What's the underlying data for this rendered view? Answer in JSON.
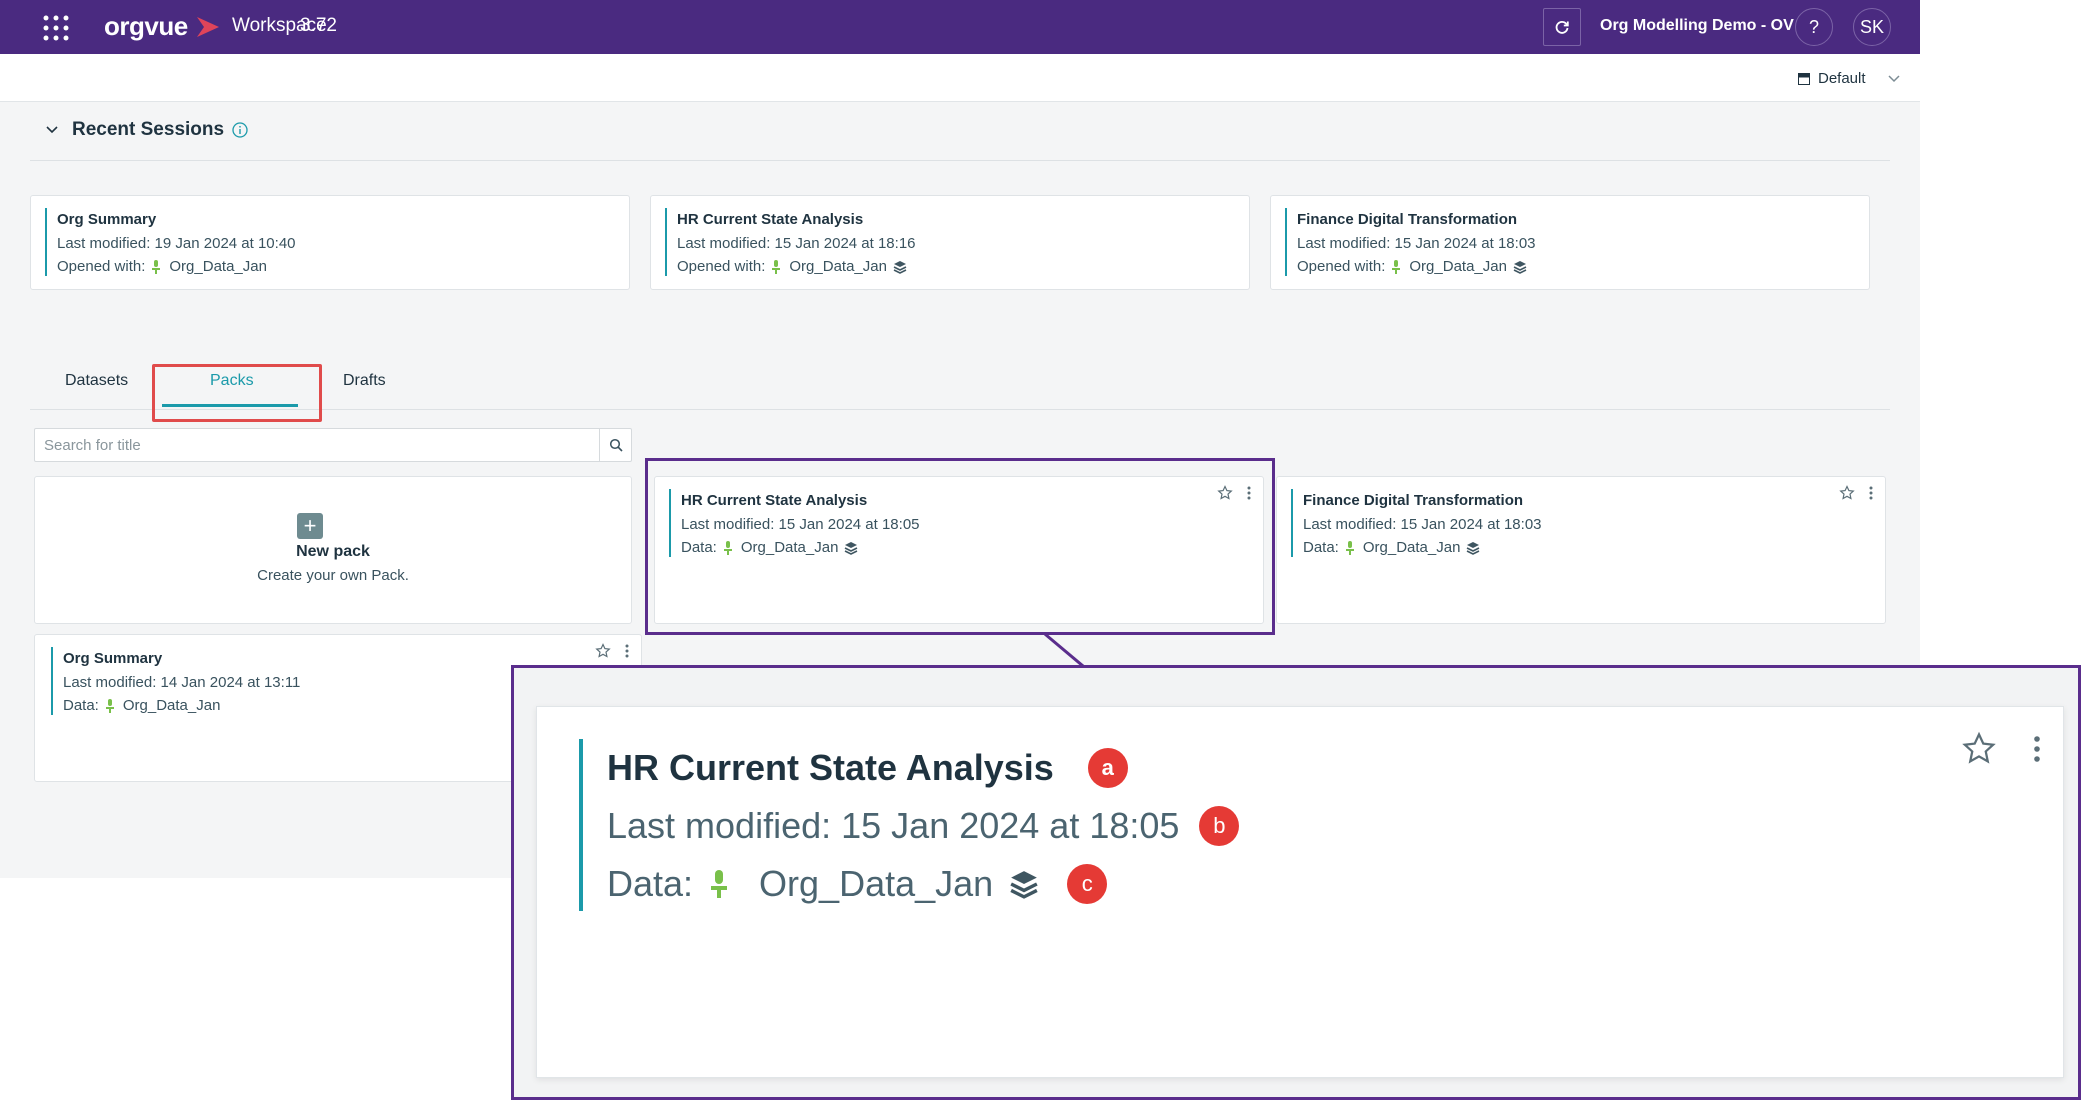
{
  "app": {
    "logo_text": "orgvue",
    "name": "Workspace",
    "version": "3.72",
    "workspace_name": "Org Modelling Demo - OV",
    "help_label": "?",
    "user_initials": "SK",
    "brand_color": "#4a2a80",
    "accent_color": "#1b9aaa"
  },
  "subbar": {
    "layout_label": "Default"
  },
  "recent_sessions": {
    "title": "Recent Sessions",
    "items": [
      {
        "title": "Org Summary",
        "modified": "Last modified: 19 Jan 2024 at 10:40",
        "opened_label": "Opened with:",
        "dataset": "Org_Data_Jan"
      },
      {
        "title": "HR Current State Analysis",
        "modified": "Last modified: 15 Jan 2024 at 18:16",
        "opened_label": "Opened with:",
        "dataset": "Org_Data_Jan"
      },
      {
        "title": "Finance Digital Transformation",
        "modified": "Last modified: 15 Jan 2024 at 18:03",
        "opened_label": "Opened with:",
        "dataset": "Org_Data_Jan"
      }
    ]
  },
  "tabs": [
    {
      "label": "Datasets"
    },
    {
      "label": "Packs",
      "active": true
    },
    {
      "label": "Drafts"
    }
  ],
  "search": {
    "placeholder": "Search for title"
  },
  "new_pack": {
    "title": "New pack",
    "subtitle": "Create your own Pack."
  },
  "packs": [
    {
      "title": "HR Current State Analysis",
      "modified": "Last modified: 15 Jan 2024 at 18:05",
      "data_label": "Data:",
      "dataset": "Org_Data_Jan"
    },
    {
      "title": "Finance Digital Transformation",
      "modified": "Last modified: 15 Jan 2024 at 18:03",
      "data_label": "Data:",
      "dataset": "Org_Data_Jan"
    },
    {
      "title": "Org Summary",
      "modified": "Last modified: 14 Jan 2024 at 13:11",
      "data_label": "Data:",
      "dataset": "Org_Data_Jan"
    }
  ],
  "zoom": {
    "title": "HR Current State Analysis",
    "modified": "Last modified: 15 Jan 2024 at 18:05",
    "data_label": "Data:",
    "dataset": "Org_Data_Jan",
    "badges": [
      "a",
      "b",
      "c"
    ]
  }
}
